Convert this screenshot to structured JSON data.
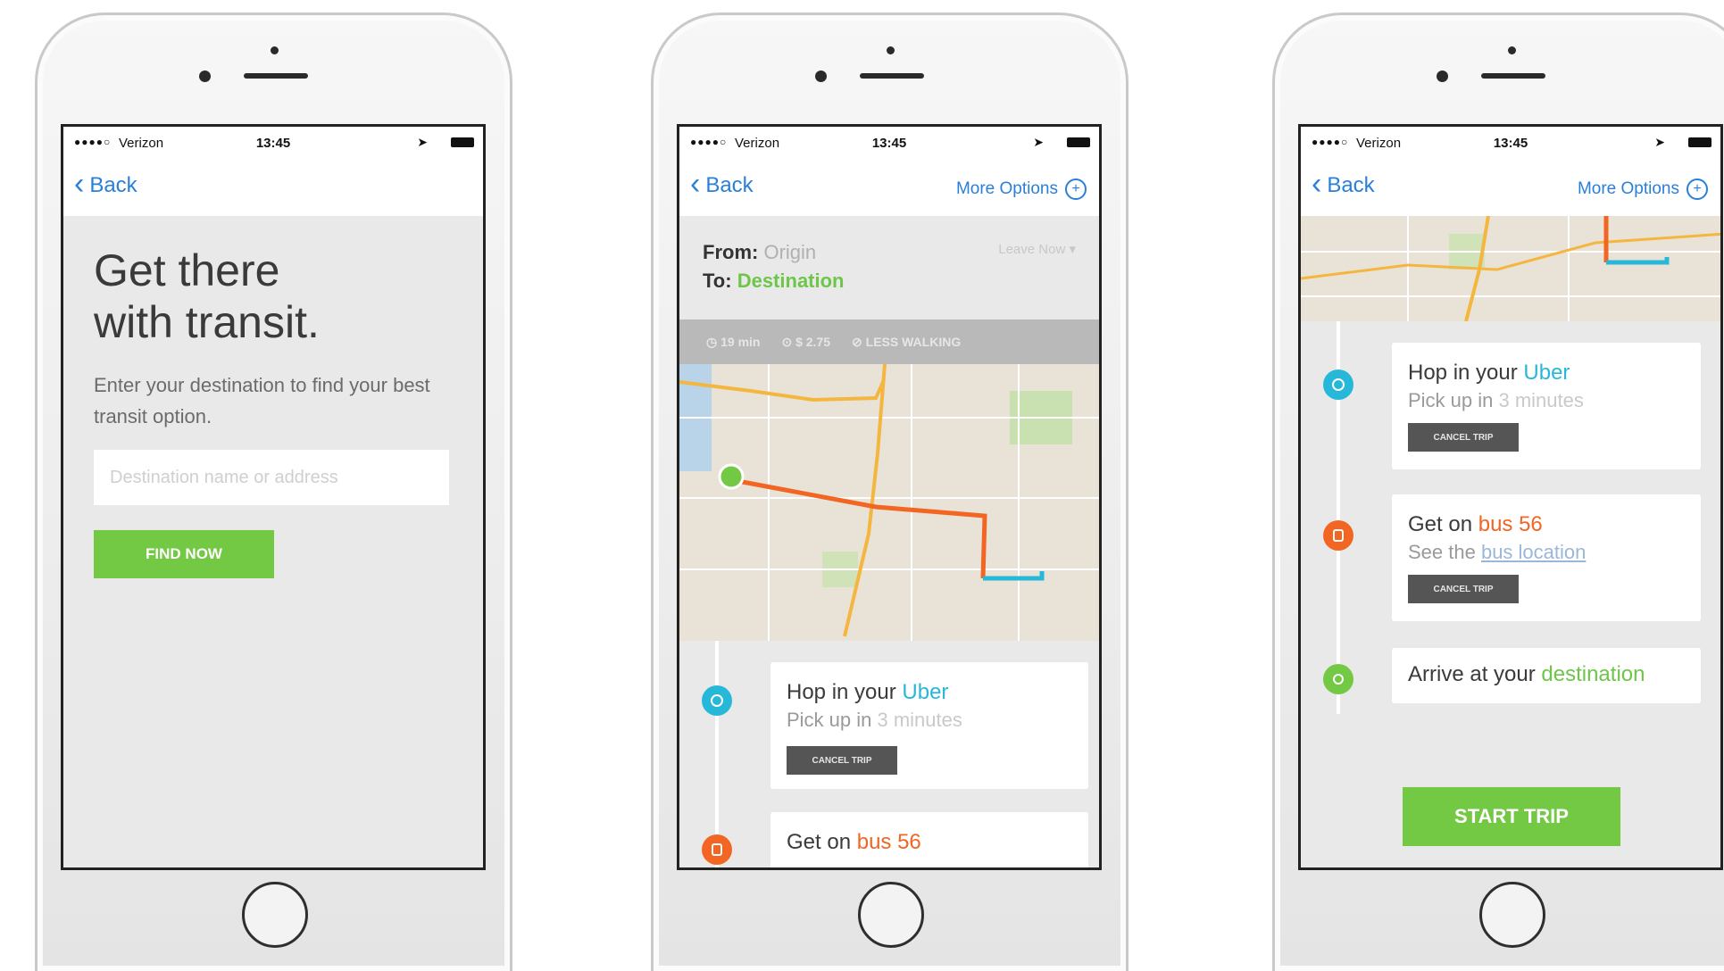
{
  "status": {
    "signal": "●●●●○",
    "carrier": "Verizon",
    "time": "13:45"
  },
  "nav": {
    "back": "Back",
    "more_options": "More Options"
  },
  "screen1": {
    "title_line1": "Get there",
    "title_line2": "with transit.",
    "subtitle": "Enter your destination to find your best transit option.",
    "input_placeholder": "Destination name or address",
    "button": "FIND NOW"
  },
  "screen2": {
    "from_label": "From:",
    "from_value": "Origin",
    "to_label": "To:",
    "to_value": "Destination",
    "leave": "Leave Now ▾",
    "options": [
      "19 min",
      "$ 2.75",
      "LESS WALKING"
    ]
  },
  "steps": {
    "uber_line1_pre": "Hop in your ",
    "uber_name": "Uber",
    "uber_line2_pre": "Pick up in ",
    "uber_eta": "3 minutes",
    "cancel": "CANCEL TRIP",
    "bus_line1_pre": "Get on ",
    "bus_name": "bus 56",
    "bus_line2_pre": "See the ",
    "bus_link": "bus location",
    "arrive_pre": "Arrive at your ",
    "arrive_dest": "destination"
  },
  "screen3": {
    "start": "START TRIP"
  },
  "colors": {
    "green": "#74c944",
    "uber": "#27b7d8",
    "bus": "#f26522",
    "link": "#2a7fd8"
  }
}
